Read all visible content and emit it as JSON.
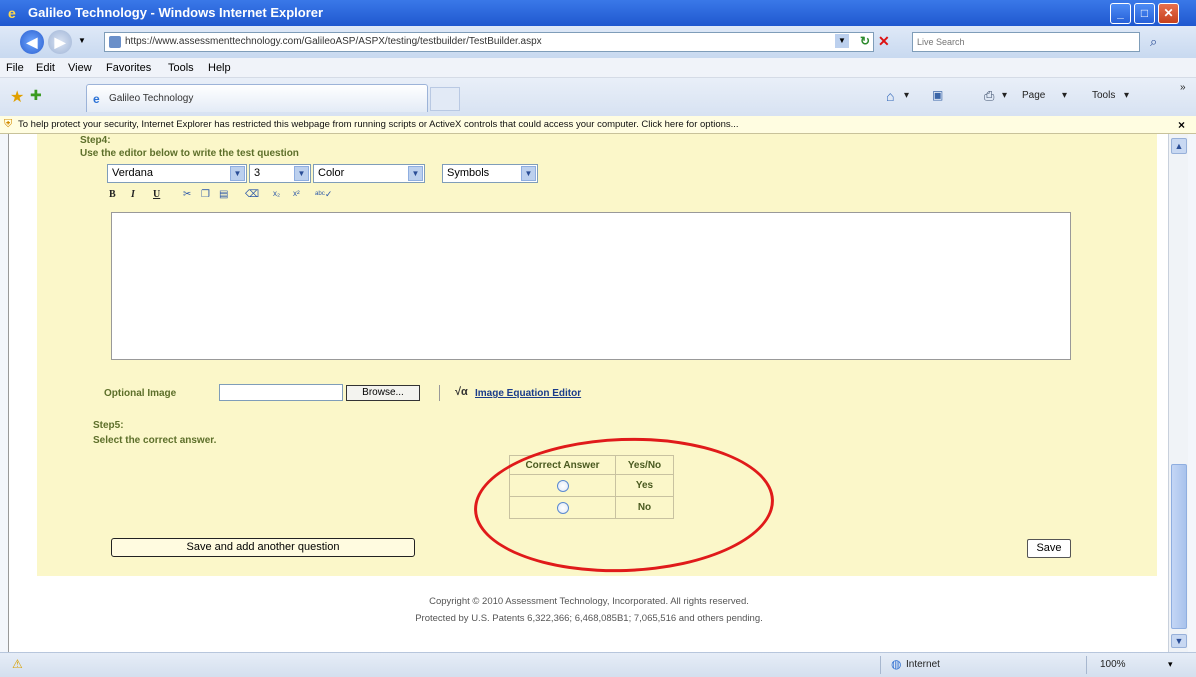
{
  "window": {
    "title": "Galileo Technology - Windows Internet Explorer"
  },
  "address": {
    "url": "https://www.assessmenttechnology.com/GalileoASP/ASPX/testing/testbuilder/TestBuilder.aspx",
    "search_placeholder": "Live Search"
  },
  "menu": {
    "file": "File",
    "edit": "Edit",
    "view": "View",
    "favorites": "Favorites",
    "tools": "Tools",
    "help": "Help"
  },
  "tabs": [
    {
      "label": "Galileo Technology"
    }
  ],
  "command_bar": {
    "page": "Page",
    "tools": "Tools"
  },
  "security_bar": {
    "message": "To help protect your security, Internet Explorer has restricted this webpage from running scripts or ActiveX controls that could access your computer. Click here for options..."
  },
  "step4": {
    "heading": "Step4:",
    "instruction": "Use the editor below to write the test question"
  },
  "editor": {
    "font": "Verdana",
    "size": "3",
    "color": "Color",
    "symbols": "Symbols",
    "tools": [
      "B",
      "I",
      "U",
      "cut",
      "copy",
      "paste",
      "eraser",
      "subscript",
      "superscript",
      "spellcheck"
    ]
  },
  "optional_image": {
    "label": "Optional Image",
    "browse": "Browse...",
    "equation_link": "Image Equation Editor"
  },
  "step5": {
    "heading": "Step5:",
    "instruction": "Select the correct answer."
  },
  "answer_table": {
    "headers": [
      "Correct Answer",
      "Yes/No"
    ],
    "rows": [
      {
        "value": "Yes"
      },
      {
        "value": "No"
      }
    ]
  },
  "buttons": {
    "save_and_add": "Save and add another question",
    "save": "Save"
  },
  "footer": {
    "copyright": "Copyright © 2010 Assessment Technology, Incorporated. All rights reserved.",
    "patents": "Protected by U.S. Patents 6,322,366; 6,468,085B1; 7,065,516 and others pending."
  },
  "status": {
    "zone": "Internet",
    "zoom": "100%"
  }
}
